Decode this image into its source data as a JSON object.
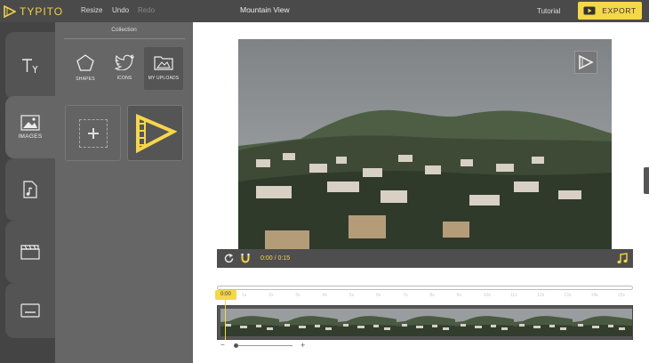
{
  "app": {
    "logo_text": "TYPITO"
  },
  "menu": {
    "resize": "Resize",
    "undo": "Undo",
    "redo": "Redo"
  },
  "document": {
    "title": "Mountain View"
  },
  "header": {
    "tutorial": "Tutorial",
    "export": "EXPORT"
  },
  "rail": {
    "images_label": "IMAGES"
  },
  "panel": {
    "title": "Collection",
    "tabs": {
      "shapes": "SHAPES",
      "icons": "ICONS",
      "uploads": "MY UPLOADS"
    }
  },
  "player": {
    "time": "0:00 / 0:15"
  },
  "timeline": {
    "playhead": "0:00",
    "ticks": [
      "1s",
      "2s",
      "3s",
      "4s",
      "5s",
      "6s",
      "7s",
      "8s",
      "9s",
      "10s",
      "11s",
      "12s",
      "13s",
      "14s",
      "15s"
    ],
    "duration": "0:15",
    "zoom_minus": "−",
    "zoom_plus": "+"
  },
  "colors": {
    "accent": "#f6d64a",
    "topbar": "#4a4a4a",
    "panel": "#666666",
    "rail": "#444444"
  },
  "icons": {
    "logo": "typito-logo-icon",
    "text_tool": "text-tool-icon",
    "images": "image-icon",
    "music": "music-file-icon",
    "clapper": "clapperboard-icon",
    "captions": "subtitles-icon",
    "shapes": "pentagon-icon",
    "icons": "twitter-bird-icon",
    "uploads": "folder-image-icon",
    "add": "plus-icon",
    "replay": "replay-icon",
    "magnet": "magnet-icon",
    "audio": "music-note-icon",
    "export": "video-play-icon"
  }
}
